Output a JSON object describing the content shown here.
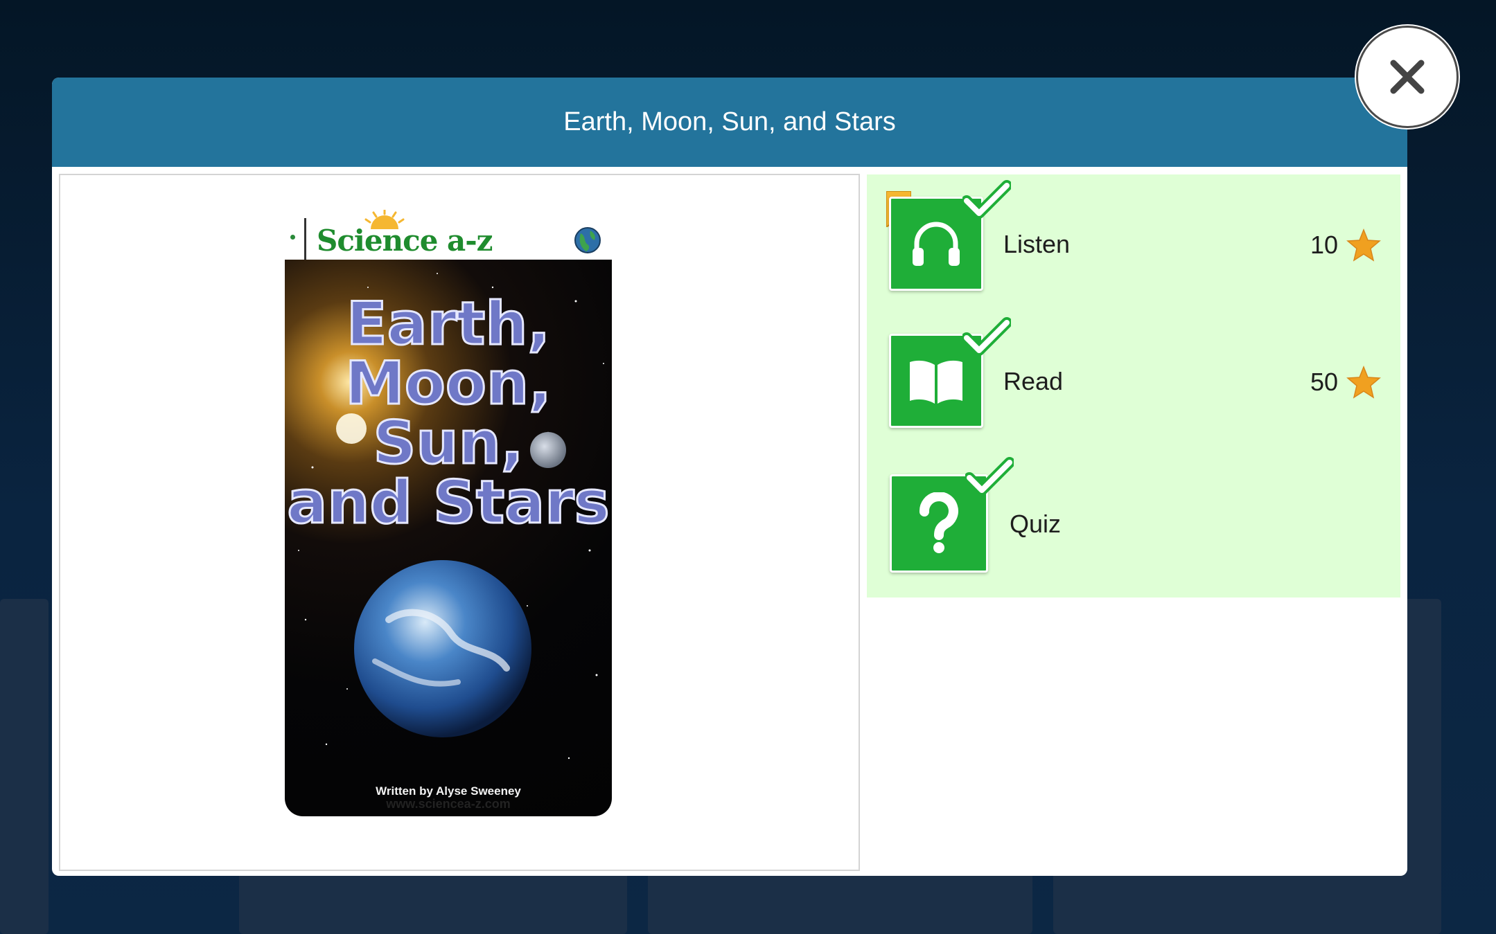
{
  "modal": {
    "title": "Earth, Moon, Sun, and Stars"
  },
  "close": {
    "icon": "close-icon"
  },
  "book_cover": {
    "brand": "Science a-z",
    "title_lines": [
      "Earth,",
      "Moon,",
      "Sun,",
      "and Stars"
    ],
    "author": "Written by Alyse Sweeney",
    "url": "www.sciencea-z.com"
  },
  "activities": [
    {
      "label": "Listen",
      "stars": "10",
      "icon": "headphones-icon",
      "completed": true,
      "bookmarked": true
    },
    {
      "label": "Read",
      "stars": "50",
      "icon": "book-icon",
      "completed": true,
      "bookmarked": false
    },
    {
      "label": "Quiz",
      "stars": "",
      "icon": "question-mark-icon",
      "completed": true,
      "bookmarked": false
    }
  ],
  "colors": {
    "header": "#23749c",
    "activity_bg": "#dfffd6",
    "tile": "#1fae38",
    "star": "#f0a020",
    "bookmark": "#f5b731"
  }
}
